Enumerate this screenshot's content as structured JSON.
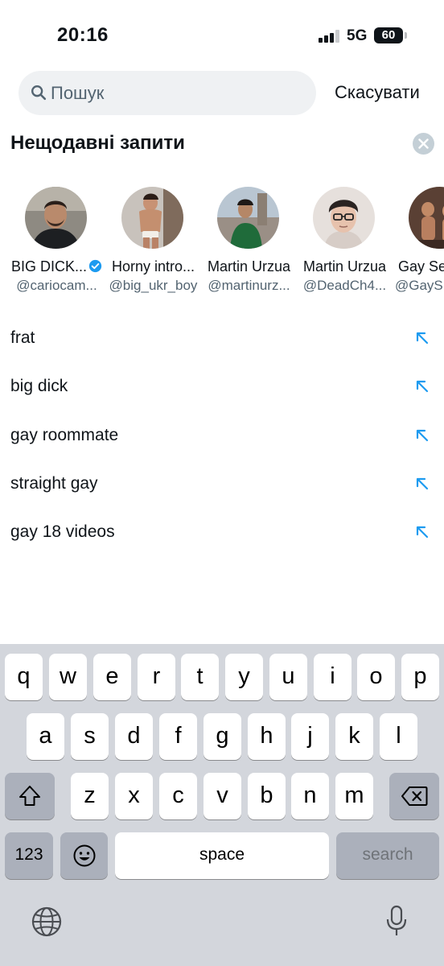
{
  "status": {
    "time": "20:16",
    "network": "5G",
    "battery": "60"
  },
  "search": {
    "placeholder": "Пошук",
    "value": "",
    "cancel_label": "Скасувати"
  },
  "recent": {
    "title": "Нещодавні запити",
    "accounts": [
      {
        "name": "BIG DICK...",
        "handle": "@cariocam...",
        "verified": true
      },
      {
        "name": "Horny intro...",
        "handle": "@big_ukr_boy",
        "verified": false
      },
      {
        "name": "Martin Urzua",
        "handle": "@martinurz...",
        "verified": false
      },
      {
        "name": "Martin Urzua",
        "handle": "@DeadCh4...",
        "verified": false
      },
      {
        "name": "Gay Se",
        "handle": "@GayS",
        "verified": false
      }
    ],
    "queries": [
      "frat",
      "big dick",
      "gay roommate",
      "straight gay",
      "gay 18 videos"
    ]
  },
  "keyboard": {
    "row1": [
      "q",
      "w",
      "e",
      "r",
      "t",
      "y",
      "u",
      "i",
      "o",
      "p"
    ],
    "row2": [
      "a",
      "s",
      "d",
      "f",
      "g",
      "h",
      "j",
      "k",
      "l"
    ],
    "row3": [
      "z",
      "x",
      "c",
      "v",
      "b",
      "n",
      "m"
    ],
    "numbers_label": "123",
    "space_label": "space",
    "return_label": "search"
  },
  "colors": {
    "accent": "#1d9bf0",
    "keyboard_bg": "#d3d6dc",
    "search_bg": "#eff1f3"
  }
}
